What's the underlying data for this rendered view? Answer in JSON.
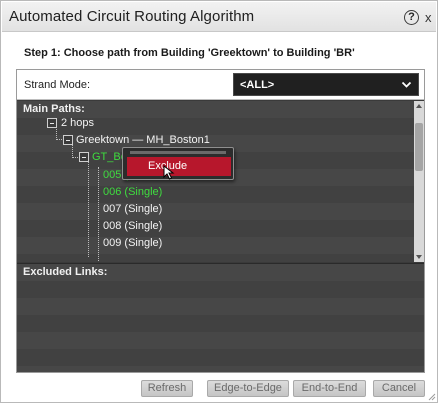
{
  "dialog": {
    "title": "Automated Circuit Routing Algorithm",
    "help_glyph": "?",
    "close_glyph": "x"
  },
  "step_label": "Step 1: Choose path from Building 'Greektown' to Building 'BR'",
  "strand": {
    "label": "Strand Mode:",
    "selected": "<ALL>"
  },
  "main_paths": {
    "header": "Main Paths:",
    "hops": "2 hops",
    "link": "Greektown — MH_Boston1",
    "node": "GT_Bos",
    "strands": [
      {
        "label": "005 (",
        "color": "#3fdc3f"
      },
      {
        "label": "006 (Single)",
        "color": "#3fdc3f"
      },
      {
        "label": "007 (Single)",
        "color": "#f3f3f3"
      },
      {
        "label": "008 (Single)",
        "color": "#f3f3f3"
      },
      {
        "label": "009 (Single)",
        "color": "#f3f3f3"
      }
    ]
  },
  "excluded_links": {
    "header": "Excluded Links:"
  },
  "context_menu": {
    "exclude_label": "Exclude"
  },
  "footer": {
    "refresh": "Refresh",
    "edge_to_edge": "Edge-to-Edge",
    "end_to_end": "End-to-End",
    "cancel": "Cancel"
  },
  "colors": {
    "accent_red": "#b7172c",
    "path_green": "#3fdc3f",
    "panel_dark": "#3a3a3a"
  }
}
